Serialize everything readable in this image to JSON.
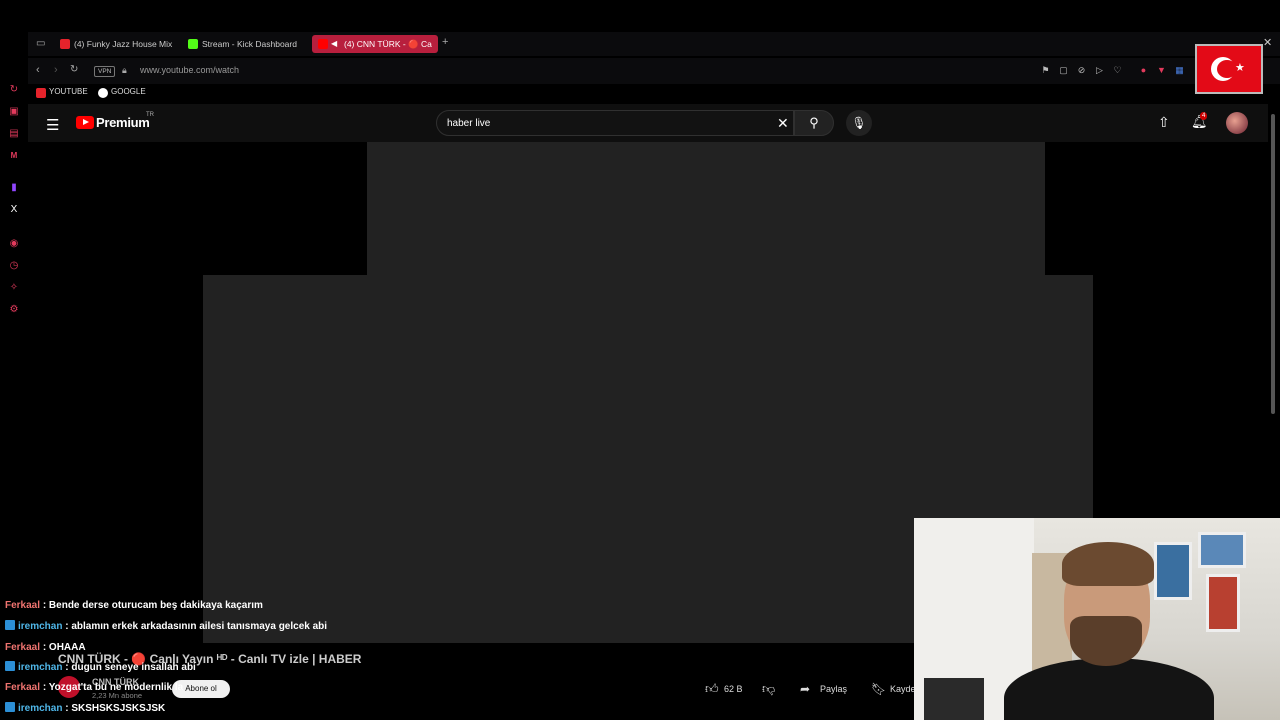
{
  "browser": {
    "tabs": [
      {
        "label": "(4) Funky Jazz House Mix",
        "icon_color": "#e5232b"
      },
      {
        "label": "Stream - Kick Dashboard",
        "icon_color": "#53fc18"
      },
      {
        "label": "(4) CNN TÜRK - 🔴 Ca",
        "icon_color": "#ff0000",
        "active": true
      }
    ],
    "new_tab": "+",
    "vpn_label": "VPN",
    "url": "www.youtube.com/watch",
    "bookmarks": [
      {
        "label": "YOUTUBE",
        "icon_color": "#e5232b"
      },
      {
        "label": "GOOGLE",
        "icon_color": "#ffffff"
      }
    ]
  },
  "youtube": {
    "logo_text": "Premium",
    "region": "TR",
    "search_value": "haber live",
    "notification_count": "4",
    "video_title": "CNN TÜRK - 🔴 Canlı Yayın ᴴᴰ - Canlı TV izle | HABER",
    "channel_name": "CNN TÜRK",
    "subscribers": "2,23 Mn abone",
    "subscribe_label": "Abone ol",
    "likes": "62 B",
    "share_label": "Paylaş",
    "save_label": "Kayde"
  },
  "chat": [
    {
      "user": "Ferkaal",
      "message": ": Bende derse oturucam beş dakikaya kaçarım",
      "badge": false
    },
    {
      "user": "iremchan",
      "message": ": ablamın erkek arkadasının ailesi tanısmaya gelcek abi",
      "badge": true
    },
    {
      "user": "Ferkaal",
      "message": ": OHAAA",
      "badge": false
    },
    {
      "user": "iremchan",
      "message": ": dugun seneye insallah abi",
      "badge": true
    },
    {
      "user": "Ferkaal",
      "message": ": Yozgat'ta bu ne modernlik la",
      "badge": false
    },
    {
      "user": "iremchan",
      "message": ": SKSHSKSJSKSJSK",
      "badge": true
    }
  ],
  "colors": {
    "accent": "#b81f3d",
    "sidebar_icons": "#e23a5c",
    "chat_name_red": "#f07470",
    "chat_name_blue": "#4fb6e8"
  }
}
